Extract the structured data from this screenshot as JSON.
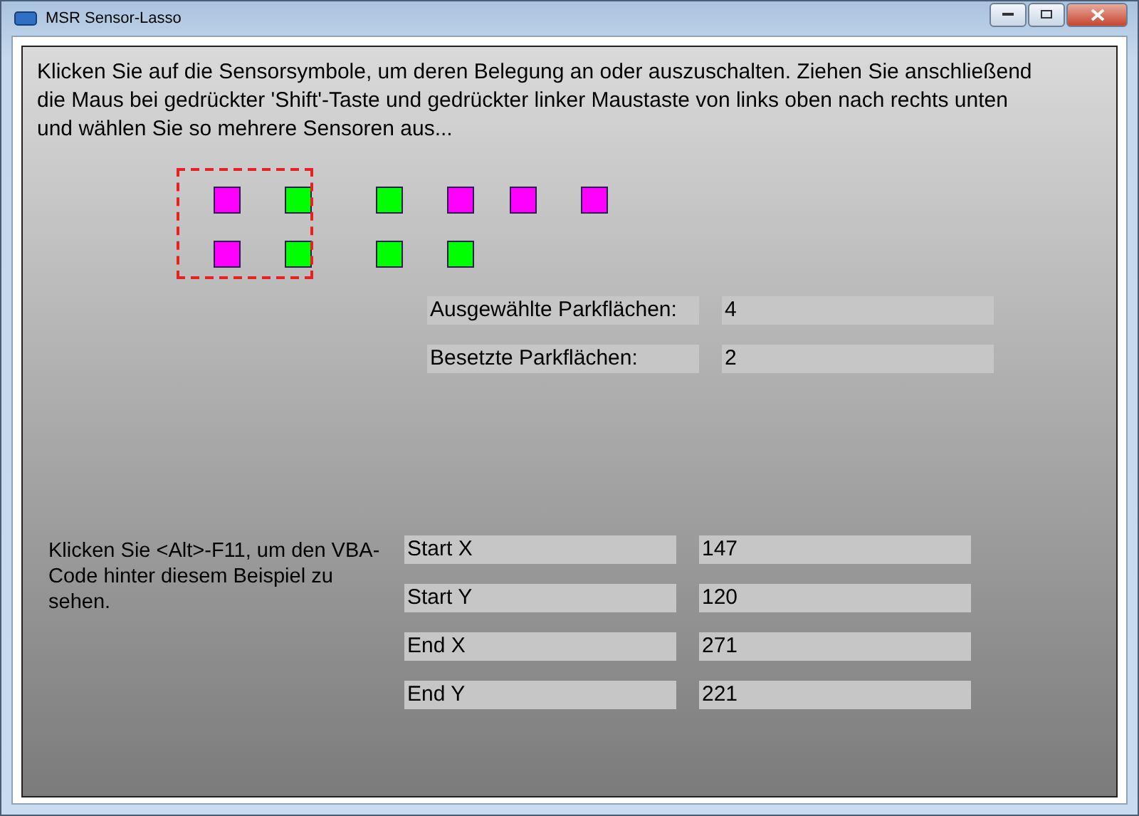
{
  "window": {
    "title": "MSR Sensor-Lasso"
  },
  "instructions": "Klicken Sie auf die Sensorsymbole, um deren Belegung an oder auszuschalten. Ziehen Sie anschließend die Maus bei gedrückter 'Shift'-Taste und gedrückter linker Maustaste von links oben nach rechts unten und wählen Sie so mehrere Sensoren aus...",
  "sensor_rows": [
    [
      {
        "occupied": true
      },
      {
        "occupied": false
      },
      {
        "occupied": false
      },
      {
        "occupied": true
      },
      {
        "occupied": true
      },
      {
        "occupied": true
      }
    ],
    [
      {
        "occupied": true
      },
      {
        "occupied": false
      },
      {
        "occupied": false
      },
      {
        "occupied": false
      }
    ]
  ],
  "summary": [
    {
      "label": "Ausgewählte Parkflächen:",
      "value": "4"
    },
    {
      "label": "Besetzte Parkflächen:",
      "value": "2"
    }
  ],
  "hint": "Klicken Sie <Alt>-F11, um den VBA-Code hinter diesem Beispiel zu sehen.",
  "coordinates": [
    {
      "label": "Start X",
      "value": "147"
    },
    {
      "label": "Start Y",
      "value": "120"
    },
    {
      "label": "End X",
      "value": "271"
    },
    {
      "label": "End Y",
      "value": "221"
    }
  ]
}
